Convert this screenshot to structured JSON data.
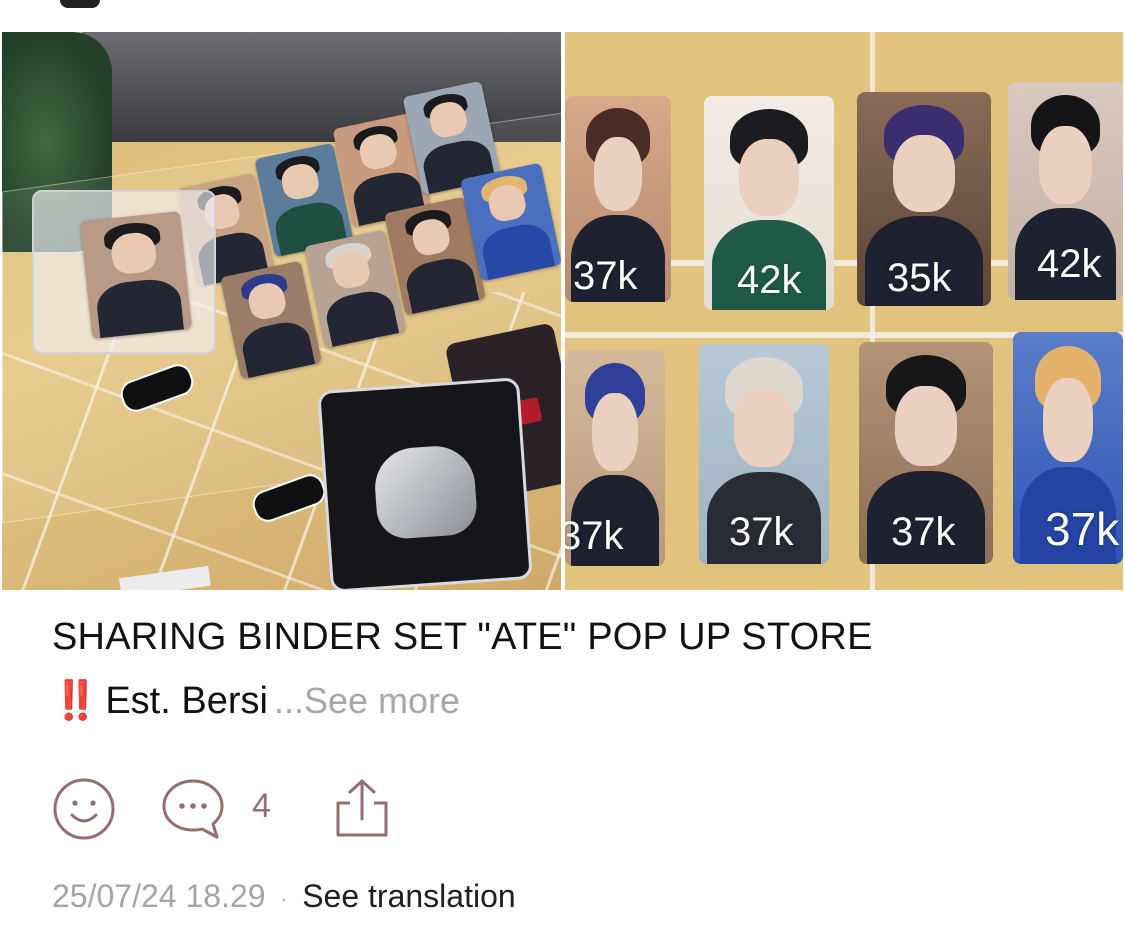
{
  "post": {
    "title": "SHARING BINDER SET \"ATE\" POP UP STORE",
    "emoji": "‼️",
    "snippet": "Est. Bersi",
    "see_more": "...See more",
    "timestamp": "25/07/24 18.29",
    "separator": "·",
    "translate_label": "See translation"
  },
  "actions": {
    "reaction_icon": "smiley-icon",
    "comment_icon": "comment-bubble-icon",
    "comment_count": "4",
    "share_icon": "share-icon"
  },
  "gallery": {
    "right_photo_prices": {
      "row1": [
        "37k",
        "42k",
        "35k",
        "42k"
      ],
      "row2": [
        "37k",
        "37k",
        "37k",
        "37k"
      ]
    }
  },
  "colors": {
    "icon": "#946e6e",
    "alert": "#e0281a",
    "muted_text": "#a5a5a5"
  }
}
